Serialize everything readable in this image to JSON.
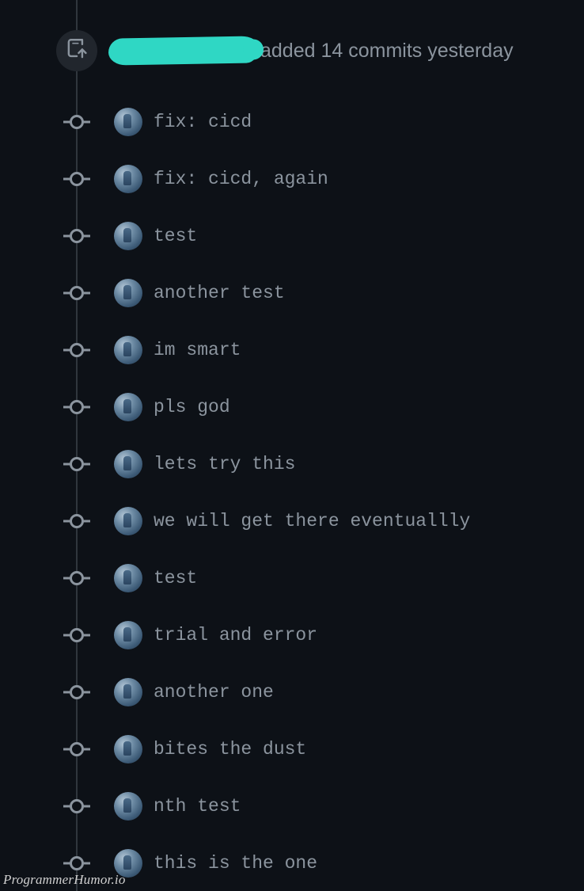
{
  "header": {
    "text": "added 14 commits yesterday"
  },
  "commits": [
    {
      "message": "fix: cicd"
    },
    {
      "message": "fix: cicd, again"
    },
    {
      "message": "test"
    },
    {
      "message": "another test"
    },
    {
      "message": "im smart"
    },
    {
      "message": "pls god"
    },
    {
      "message": "lets try this"
    },
    {
      "message": "we will get there eventuallly"
    },
    {
      "message": "test"
    },
    {
      "message": "trial and error"
    },
    {
      "message": "another one"
    },
    {
      "message": "bites the dust"
    },
    {
      "message": "nth test"
    },
    {
      "message": "this is the one"
    }
  ],
  "footer": {
    "watermark": "ProgrammerHumor.io"
  }
}
